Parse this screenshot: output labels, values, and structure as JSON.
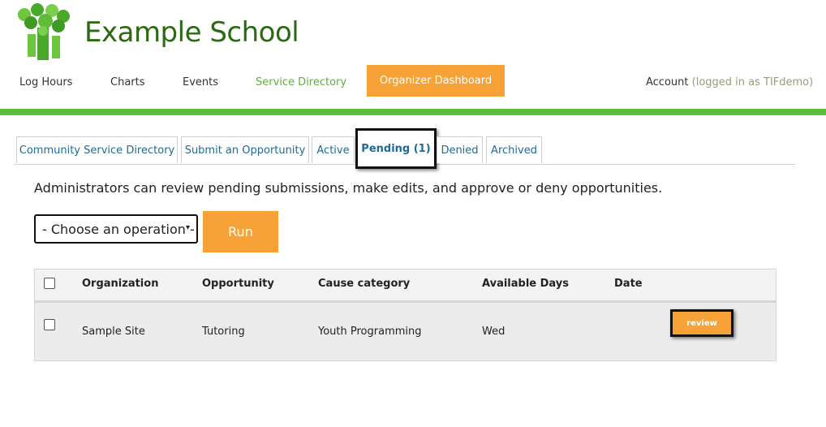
{
  "site": {
    "title": "Example School"
  },
  "nav": {
    "log_hours": "Log Hours",
    "charts": "Charts",
    "events": "Events",
    "service_directory": "Service Directory",
    "organizer_dashboard": "Organizer Dashboard",
    "account": "Account",
    "logged_in": "(logged in as TIFdemo)"
  },
  "tabs": [
    {
      "label": "Community Service Directory"
    },
    {
      "label": "Submit an Opportunity"
    },
    {
      "label": "Active"
    },
    {
      "label": "Pending (1)"
    },
    {
      "label": "Denied"
    },
    {
      "label": "Archived"
    }
  ],
  "main": {
    "description": "Administrators can review pending submissions, make edits, and approve or deny opportunities.",
    "operation_select": "- Choose an operation -",
    "run_label": "Run"
  },
  "table": {
    "headers": [
      "Organization",
      "Opportunity",
      "Cause category",
      "Available Days",
      "Date"
    ],
    "rows": [
      {
        "organization": "Sample Site",
        "opportunity": "Tutoring",
        "cause": "Youth Programming",
        "days": "Wed",
        "date": "",
        "action": "review"
      }
    ]
  },
  "colors": {
    "brand_green": "#5cbf3b",
    "accent_orange": "#f7a236",
    "title_green": "#2b6a12",
    "link_blue": "#1f6b93"
  }
}
